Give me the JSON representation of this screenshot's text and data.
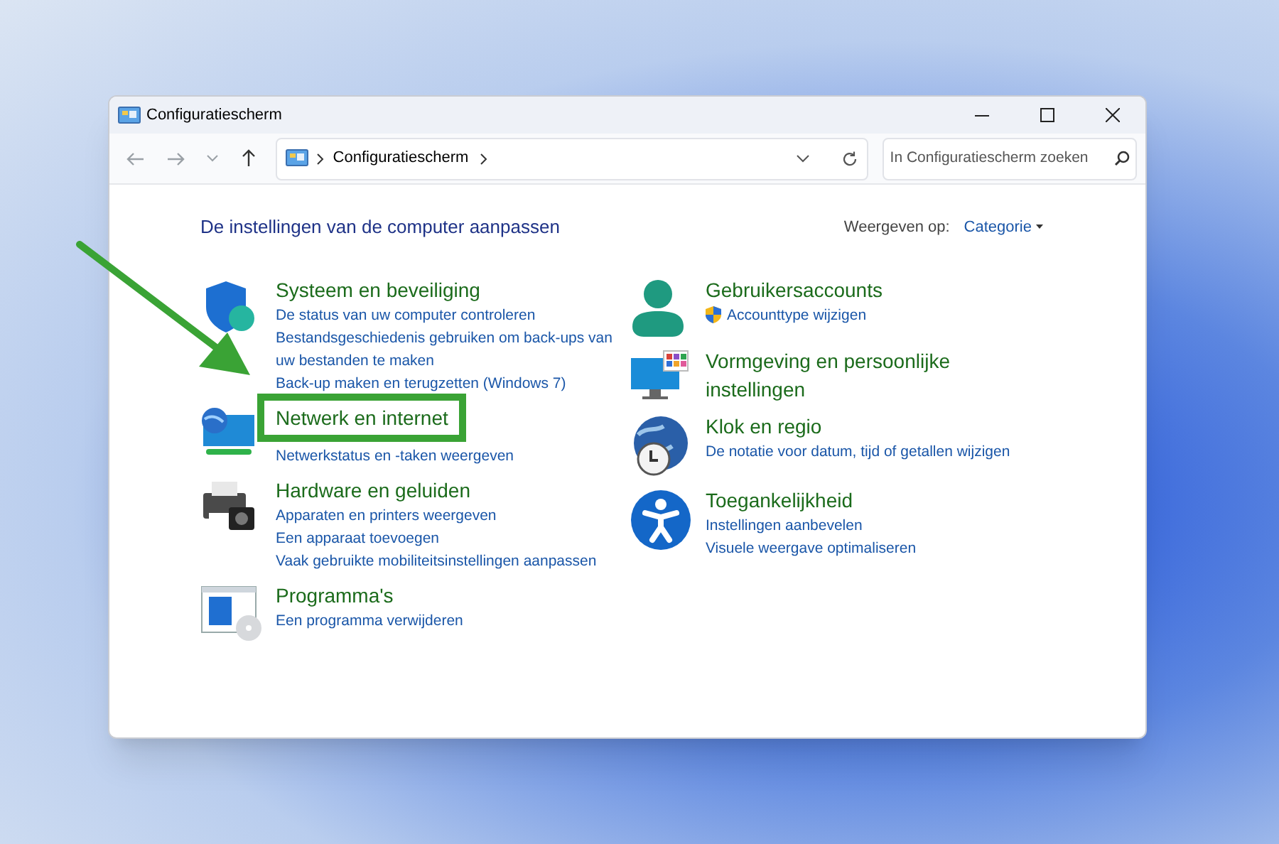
{
  "window": {
    "title": "Configuratiescherm"
  },
  "address": {
    "breadcrumb": "Configuratiescherm"
  },
  "search": {
    "placeholder": "In Configuratiescherm zoeken"
  },
  "heading": "De instellingen van de computer aanpassen",
  "view_by": {
    "label": "Weergeven op:",
    "value": "Categorie"
  },
  "columns": [
    [
      {
        "title": "Systeem en beveiliging",
        "highlighted": false,
        "links": [
          {
            "text": "De status van uw computer controleren",
            "shield": false
          },
          {
            "text": "Bestandsgeschiedenis gebruiken om back-ups van uw bestanden te maken",
            "shield": false
          },
          {
            "text": "Back-up maken en terugzetten (Windows 7)",
            "shield": false
          }
        ]
      },
      {
        "title": "Netwerk en internet",
        "highlighted": true,
        "links": [
          {
            "text": "Netwerkstatus en -taken weergeven",
            "shield": false
          }
        ]
      },
      {
        "title": "Hardware en geluiden",
        "highlighted": false,
        "links": [
          {
            "text": "Apparaten en printers weergeven",
            "shield": false
          },
          {
            "text": "Een apparaat toevoegen",
            "shield": false
          },
          {
            "text": "Vaak gebruikte mobiliteitsinstellingen aanpassen",
            "shield": false
          }
        ]
      },
      {
        "title": "Programma's",
        "highlighted": false,
        "links": [
          {
            "text": "Een programma verwijderen",
            "shield": false
          }
        ]
      }
    ],
    [
      {
        "title": "Gebruikersaccounts",
        "highlighted": false,
        "links": [
          {
            "text": "Accounttype wijzigen",
            "shield": true
          }
        ]
      },
      {
        "title": "Vormgeving en persoonlijke instellingen",
        "highlighted": false
      },
      {
        "title": "Klok en regio",
        "highlighted": false,
        "links": [
          {
            "text": "De notatie voor datum, tijd of getallen wijzigen",
            "shield": false
          }
        ]
      },
      {
        "title": "Toegankelijkheid",
        "highlighted": false,
        "links": [
          {
            "text": "Instellingen aanbevelen",
            "shield": false
          },
          {
            "text": "Visuele weergave optimaliseren",
            "shield": false
          }
        ]
      }
    ]
  ]
}
